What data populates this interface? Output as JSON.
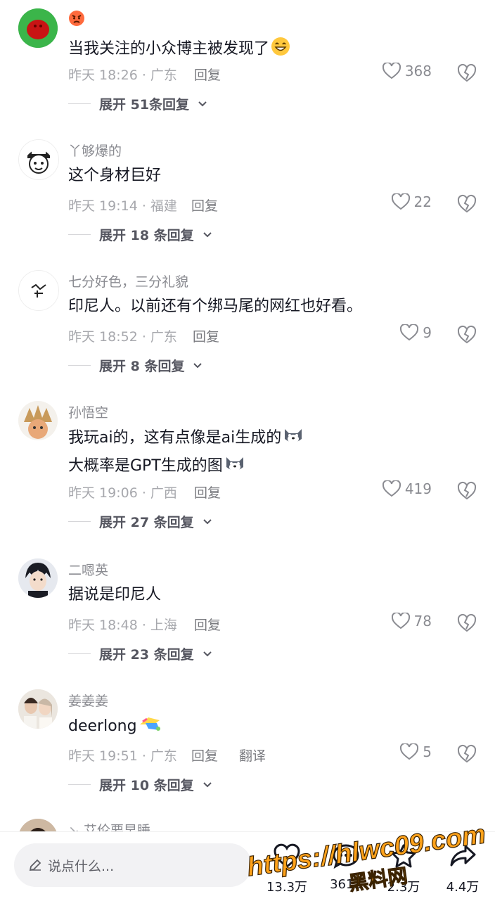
{
  "comments": [
    {
      "name": "",
      "text": "当我关注的小众博主被发现了",
      "time": "昨天 18:26 · 广东",
      "reply": "回复",
      "likes": "368",
      "expand": "展开 51条回复"
    },
    {
      "name": "丫够爆的",
      "text": "这个身材巨好",
      "time": "昨天 19:14 · 福建",
      "reply": "回复",
      "likes": "22",
      "expand": "展开 18 条回复"
    },
    {
      "name": "七分好色，三分礼貌",
      "text": "印尼人。以前还有个绑马尾的网红也好看。",
      "time": "昨天 18:52 · 广东",
      "reply": "回复",
      "likes": "9",
      "expand": "展开 8 条回复"
    },
    {
      "name": "孙悟空",
      "text": "我玩ai的，这有点像是ai生成的",
      "text2": "大概率是GPT生成的图",
      "time": "昨天 19:06 · 广西",
      "reply": "回复",
      "likes": "419",
      "expand": "展开 27 条回复"
    },
    {
      "name": "二嗯英",
      "text": "据说是印尼人",
      "time": "昨天 18:48 · 上海",
      "reply": "回复",
      "likes": "78",
      "expand": "展开 23 条回复"
    },
    {
      "name": "姜姜姜",
      "text": "deerlong",
      "time": "昨天 19:51 · 广东",
      "reply": "回复",
      "translate": "翻译",
      "likes": "5",
      "expand": "展开 10 条回复"
    },
    {
      "name": "艾伦要早睡"
    }
  ],
  "bottom_bar": {
    "placeholder": "说点什么...",
    "like_count": "13.3万",
    "comment_count": "3613",
    "favorite_count": "2.3万",
    "share_count": "4.4万"
  },
  "watermark": {
    "url": "https://hlwc09.com",
    "site": "黑料网"
  }
}
